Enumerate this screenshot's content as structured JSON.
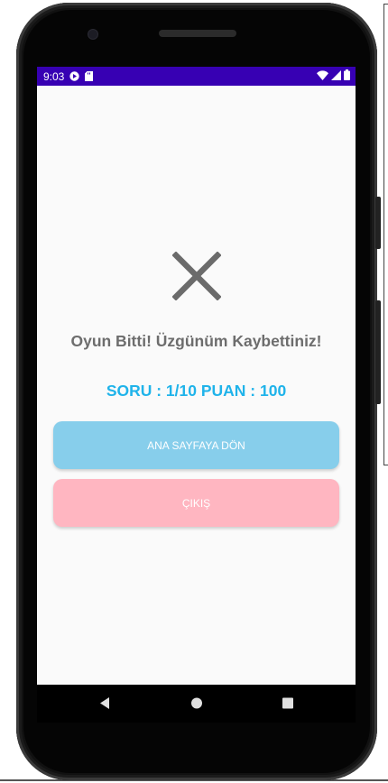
{
  "status_bar": {
    "time": "9:03",
    "bg_color": "#3700b3",
    "left_icons": [
      "play-protect-icon",
      "sd-card-icon"
    ],
    "right_icons": [
      "wifi-icon",
      "signal-icon",
      "battery-icon"
    ]
  },
  "result": {
    "icon": "close-icon",
    "message": "Oyun Bitti! Üzgünüm Kaybettiniz!",
    "score_line": "SORU : 1/10 PUAN : 100"
  },
  "buttons": {
    "home_label": "ANA SAYFAYA DÖN",
    "exit_label": "ÇIKIŞ",
    "home_color": "#87ceeb",
    "exit_color": "#ffb6c1"
  },
  "nav_bar": {
    "icons": [
      "back-icon",
      "home-icon",
      "recents-icon"
    ]
  }
}
